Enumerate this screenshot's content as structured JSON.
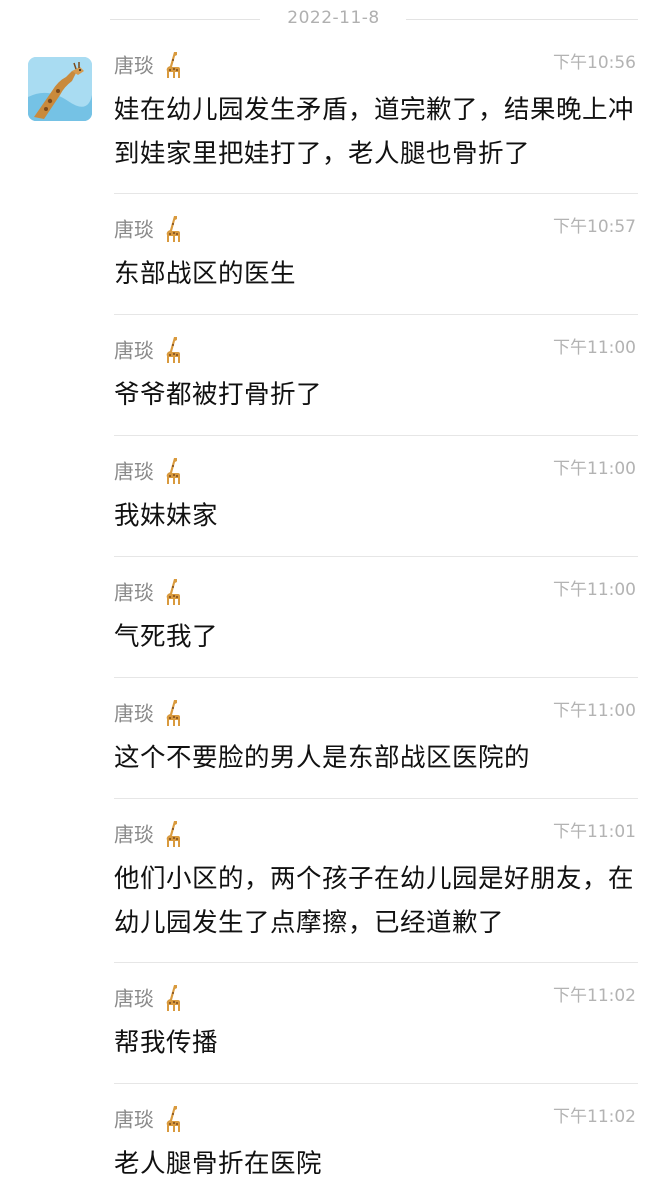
{
  "date_separator": "2022-11-8",
  "sender": {
    "name": "唐琰",
    "emoji_icon": "giraffe-icon"
  },
  "messages": [
    {
      "time": "下午10:56",
      "text": "娃在幼儿园发生矛盾，道完歉了，结果晚上冲到娃家里把娃打了，老人腿也骨折了"
    },
    {
      "time": "下午10:57",
      "text": "东部战区的医生"
    },
    {
      "time": "下午11:00",
      "text": "爷爷都被打骨折了"
    },
    {
      "time": "下午11:00",
      "text": "我妹妹家"
    },
    {
      "time": "下午11:00",
      "text": "气死我了"
    },
    {
      "time": "下午11:00",
      "text": "这个不要脸的男人是东部战区医院的"
    },
    {
      "time": "下午11:01",
      "text": "他们小区的，两个孩子在幼儿园是好朋友，在幼儿园发生了点摩擦，已经道歉了"
    },
    {
      "time": "下午11:02",
      "text": "帮我传播"
    },
    {
      "time": "下午11:02",
      "text": "老人腿骨折在医院"
    }
  ]
}
